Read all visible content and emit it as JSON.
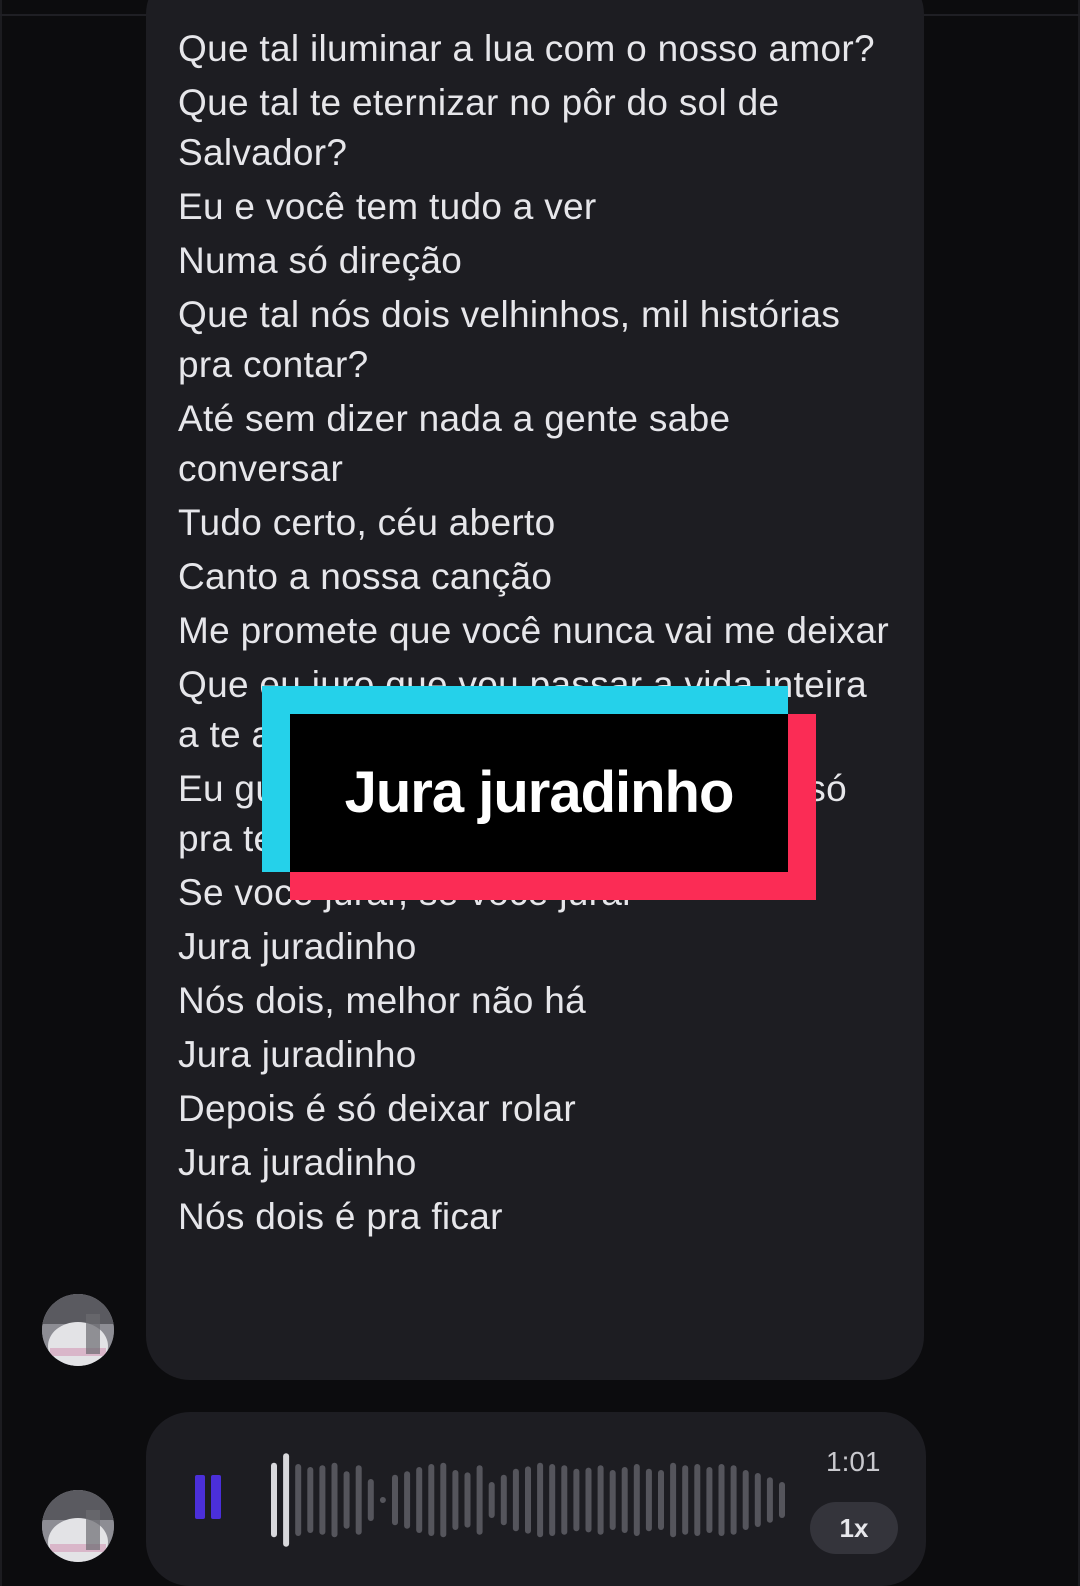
{
  "conversation": {
    "lyrics_message": {
      "lines": [
        "Que tal iluminar a lua com o nosso amor?",
        "Que tal te eternizar no pôr do sol de Salvador?",
        "Eu e você tem tudo a ver",
        "Numa só direção",
        "Que tal nós dois velhinhos, mil histórias pra contar?",
        "Até sem dizer nada a gente sabe conversar",
        "Tudo certo, céu aberto",
        "Canto a nossa canção",
        "Me promete que você nunca vai me deixar",
        "Que eu juro que vou passar a vida inteira a te amar",
        "Eu guardei o que há de bom em mim só pra te dar",
        "Se você jurar, se você jurar",
        "Jura juradinho",
        "Nós dois, melhor não há",
        "Jura juradinho",
        "Depois é só deixar rolar",
        "Jura juradinho",
        "Nós dois é pra ficar"
      ]
    },
    "audio_message": {
      "duration": "1:01",
      "playback_speed": "1x",
      "state": "playing",
      "waveform_levels": [
        0.62,
        0.78,
        0.6,
        0.55,
        0.58,
        0.62,
        0.48,
        0.58,
        0.35,
        0.04,
        0.42,
        0.48,
        0.55,
        0.6,
        0.62,
        0.5,
        0.46,
        0.58,
        0.3,
        0.42,
        0.52,
        0.56,
        0.62,
        0.6,
        0.58,
        0.52,
        0.54,
        0.58,
        0.5,
        0.55,
        0.6,
        0.52,
        0.5,
        0.62,
        0.58,
        0.6,
        0.55,
        0.6,
        0.58,
        0.5,
        0.45,
        0.38,
        0.3
      ],
      "progress": 0.05,
      "accent_color": "#4b2fd9"
    }
  },
  "overlay": {
    "title": "Jura juradinho",
    "colors": {
      "cyan": "#25d1ea",
      "pink": "#fb2c55",
      "background": "#000000"
    }
  }
}
